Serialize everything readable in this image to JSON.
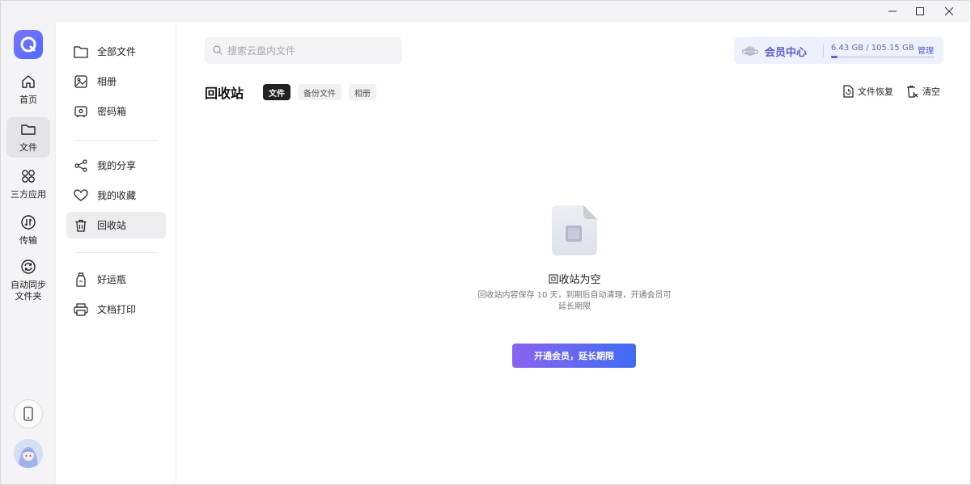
{
  "window": {
    "minimize_icon": "minimize-icon",
    "maximize_icon": "maximize-icon",
    "close_icon": "close-icon"
  },
  "rail": {
    "items": [
      {
        "label": "首页",
        "icon": "home-icon"
      },
      {
        "label": "文件",
        "icon": "folder-icon",
        "active": true
      },
      {
        "label": "三方应用",
        "icon": "apps-icon"
      },
      {
        "label": "传输",
        "icon": "transfer-icon"
      },
      {
        "label": "自动同步\n文件夹",
        "label_line1": "自动同步",
        "label_line2": "文件夹",
        "icon": "sync-icon"
      }
    ],
    "bottom": {
      "phone_icon": "phone-icon",
      "avatar_icon": "avatar"
    }
  },
  "sidebar": {
    "items": [
      {
        "label": "全部文件",
        "icon": "folder-icon"
      },
      {
        "label": "相册",
        "icon": "image-icon"
      },
      {
        "label": "密码箱",
        "icon": "safe-icon"
      },
      {
        "label": "我的分享",
        "icon": "share-icon"
      },
      {
        "label": "我的收藏",
        "icon": "heart-icon"
      },
      {
        "label": "回收站",
        "icon": "trash-icon",
        "active": true
      },
      {
        "label": "好运瓶",
        "icon": "bottle-icon"
      },
      {
        "label": "文档打印",
        "icon": "printer-icon"
      }
    ]
  },
  "search": {
    "placeholder": "搜索云盘内文件"
  },
  "vip": {
    "title": "会员中心",
    "storage": "6.43 GB / 105.15 GB",
    "manage": "管理",
    "usage_fraction": 0.061
  },
  "main": {
    "title": "回收站",
    "tabs": [
      {
        "label": "文件",
        "active": true
      },
      {
        "label": "备份文件"
      },
      {
        "label": "相册"
      }
    ],
    "actions": {
      "restore": "文件恢复",
      "clear": "清空"
    }
  },
  "empty": {
    "title": "回收站为空",
    "desc_line1": "回收站内容保存 10 天，到期后自动清理，开通会员可",
    "desc_line2": "延长期限",
    "cta": "开通会员，延长期限"
  },
  "colors": {
    "accent": "#4b5ae0",
    "cta_start": "#8a64f0",
    "cta_end": "#3f6cf2"
  }
}
